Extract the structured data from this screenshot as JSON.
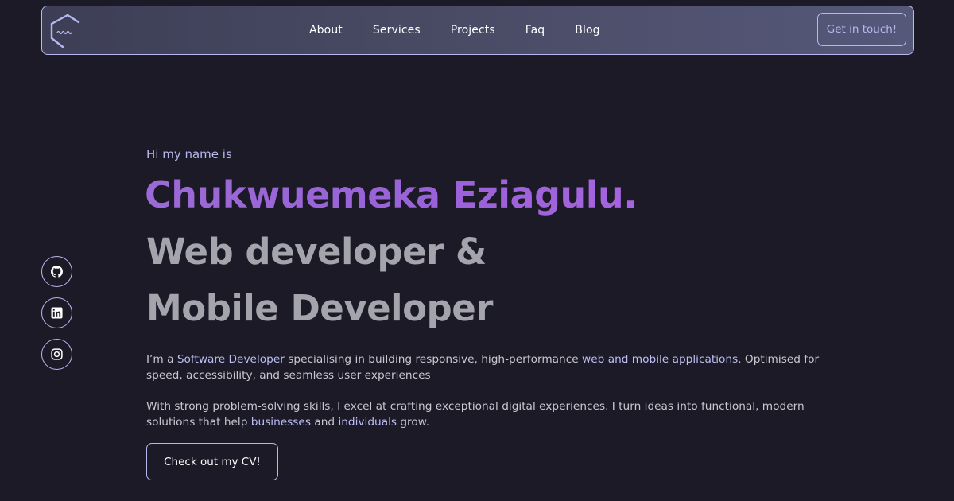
{
  "nav": {
    "links": [
      "About",
      "Services",
      "Projects",
      "Faq",
      "Blog"
    ],
    "cta": "Get in touch!"
  },
  "social": [
    {
      "icon": "github-icon"
    },
    {
      "icon": "linkedin-icon"
    },
    {
      "icon": "instagram-icon"
    }
  ],
  "hero": {
    "greeting": "Hi my name is",
    "name": "Chukwuemeka Eziagulu.",
    "role_line1": "Web developer &",
    "role_line2": "Mobile Developer",
    "p1": {
      "t1": "I’m a ",
      "h1": "Software Developer",
      "t2": " specialising in building responsive, high-performance ",
      "h2": "web and mobile applications",
      "t3": ". Optimised for speed, accessibility, and seamless user experiences"
    },
    "p2": {
      "t1": "With strong problem-solving skills, I excel at crafting exceptional digital experiences. I turn ideas into functional, modern solutions that help ",
      "h1": "businesses",
      "t2": " and ",
      "h2": "individuals",
      "t3": " grow."
    },
    "cv_button": "Check out my CV!"
  },
  "colors": {
    "background": "#1b1a26",
    "accent": "#b7b8f0",
    "name_gradient": "#9b6ad6",
    "heading_gray": "#a4a4ac"
  }
}
